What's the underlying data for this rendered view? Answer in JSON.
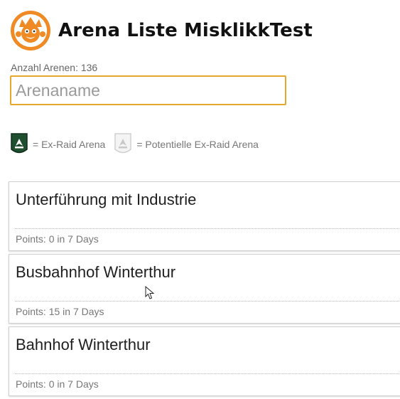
{
  "header": {
    "title": "Arena Liste MisklikkTest",
    "logo_icon": "pokemon-go-gym-logo"
  },
  "arena_count": {
    "label": "Anzahl Arenen:",
    "value": "136"
  },
  "search": {
    "placeholder": "Arenaname",
    "value": ""
  },
  "legend": {
    "ex_raid_icon": "ex-raid-badge-icon",
    "ex_raid_label": "= Ex-Raid Arena",
    "potential_icon": "potential-ex-raid-icon",
    "potential_label": "= Potentielle Ex-Raid Arena"
  },
  "arenas": [
    {
      "name": "Unterführung mit Industrie",
      "points": "Points: 0 in 7 Days"
    },
    {
      "name": "Busbahnhof Winterthur",
      "points": "Points: 15 in 7 Days"
    },
    {
      "name": "Bahnhof Winterthur",
      "points": "Points: 0 in 7 Days"
    }
  ],
  "colors": {
    "accent": "#e8a82e",
    "logo_orange": "#f08a24",
    "ex_raid_green": "#1f4f2e"
  }
}
